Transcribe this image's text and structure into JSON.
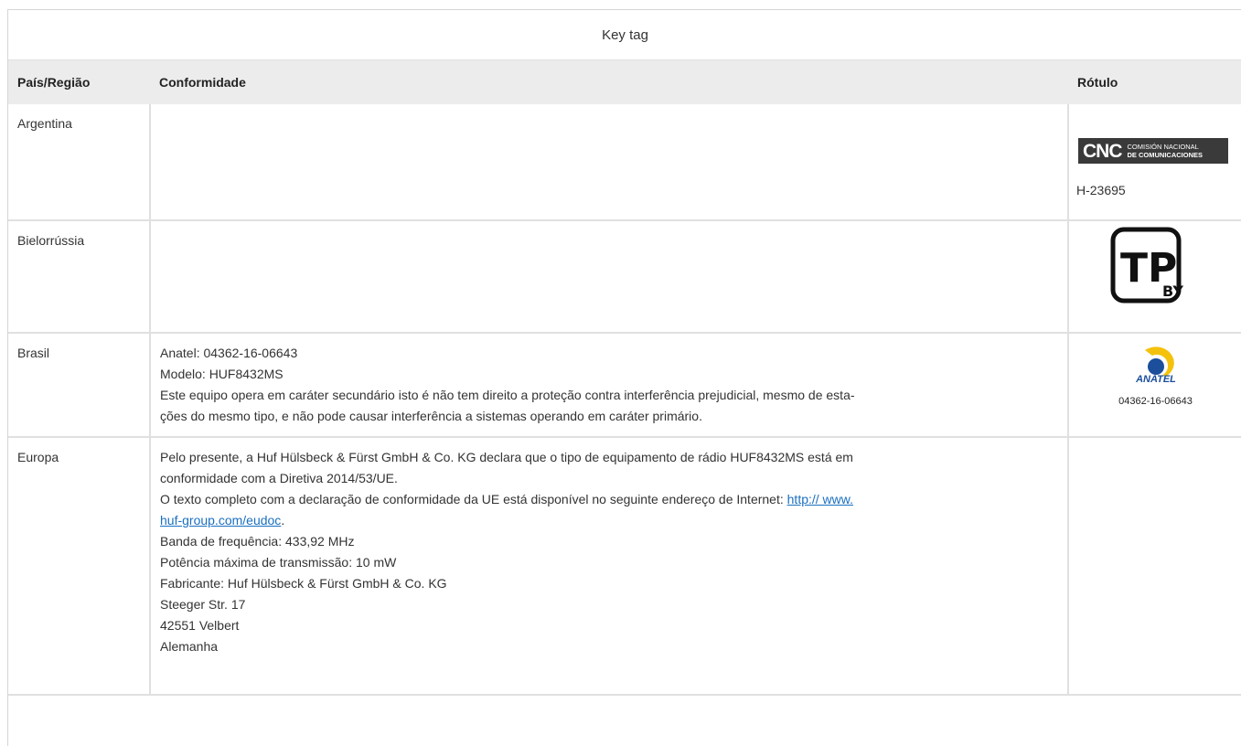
{
  "table": {
    "title": "Key tag",
    "headers": {
      "country": "País/Região",
      "compliance": "Conformidade",
      "label": "Rótulo"
    },
    "rows": {
      "argentina": {
        "country": "Argentina",
        "label_logo_text": "CNC",
        "label_logo_sub1": "COMISIÓN NACIONAL",
        "label_logo_sub2": "DE COMUNICACIONES",
        "label_code": "H-23695"
      },
      "belarus": {
        "country": "Bielorrússia",
        "label_logo_text": "TP",
        "label_logo_sub": "BY"
      },
      "brazil": {
        "country": "Brasil",
        "lines": [
          "Anatel: 04362-16-06643",
          "Modelo: HUF8432MS",
          "Este equipo opera em caráter secundário isto é não tem direito a proteção contra interferência prejudicial, mesmo de esta-",
          "ções do mesmo tipo, e não pode causar interferência a sistemas operando em caráter primário."
        ],
        "label_logo_text": "ANATEL",
        "label_code": "04362-16-06643"
      },
      "europe": {
        "country": "Europa",
        "line1": "Pelo presente, a Huf Hülsbeck & Fürst GmbH & Co. KG declara que o tipo de equipamento de rádio HUF8432MS está em",
        "line2": "conformidade com a Diretiva 2014/53/UE.",
        "line3": "O texto completo com a declaração de conformidade da UE está disponível no seguinte endereço de Internet: ",
        "link_part1": "http:// www.",
        "link_part2": "huf-group.com/eudoc",
        "link_suffix": ".",
        "line5": "Banda de frequência: 433,92 MHz",
        "line6": "Potência máxima de transmissão: 10 mW",
        "line7": "Fabricante: Huf Hülsbeck & Fürst GmbH & Co. KG",
        "line8": "Steeger Str. 17",
        "line9": "42551 Velbert",
        "line10": "Alemanha"
      }
    }
  },
  "colors": {
    "header_bg": "#ececec",
    "link": "#1a6fc0",
    "border": "#e0e0e0",
    "anatel_blue": "#1b4e9b",
    "anatel_yellow": "#f4c20d"
  }
}
